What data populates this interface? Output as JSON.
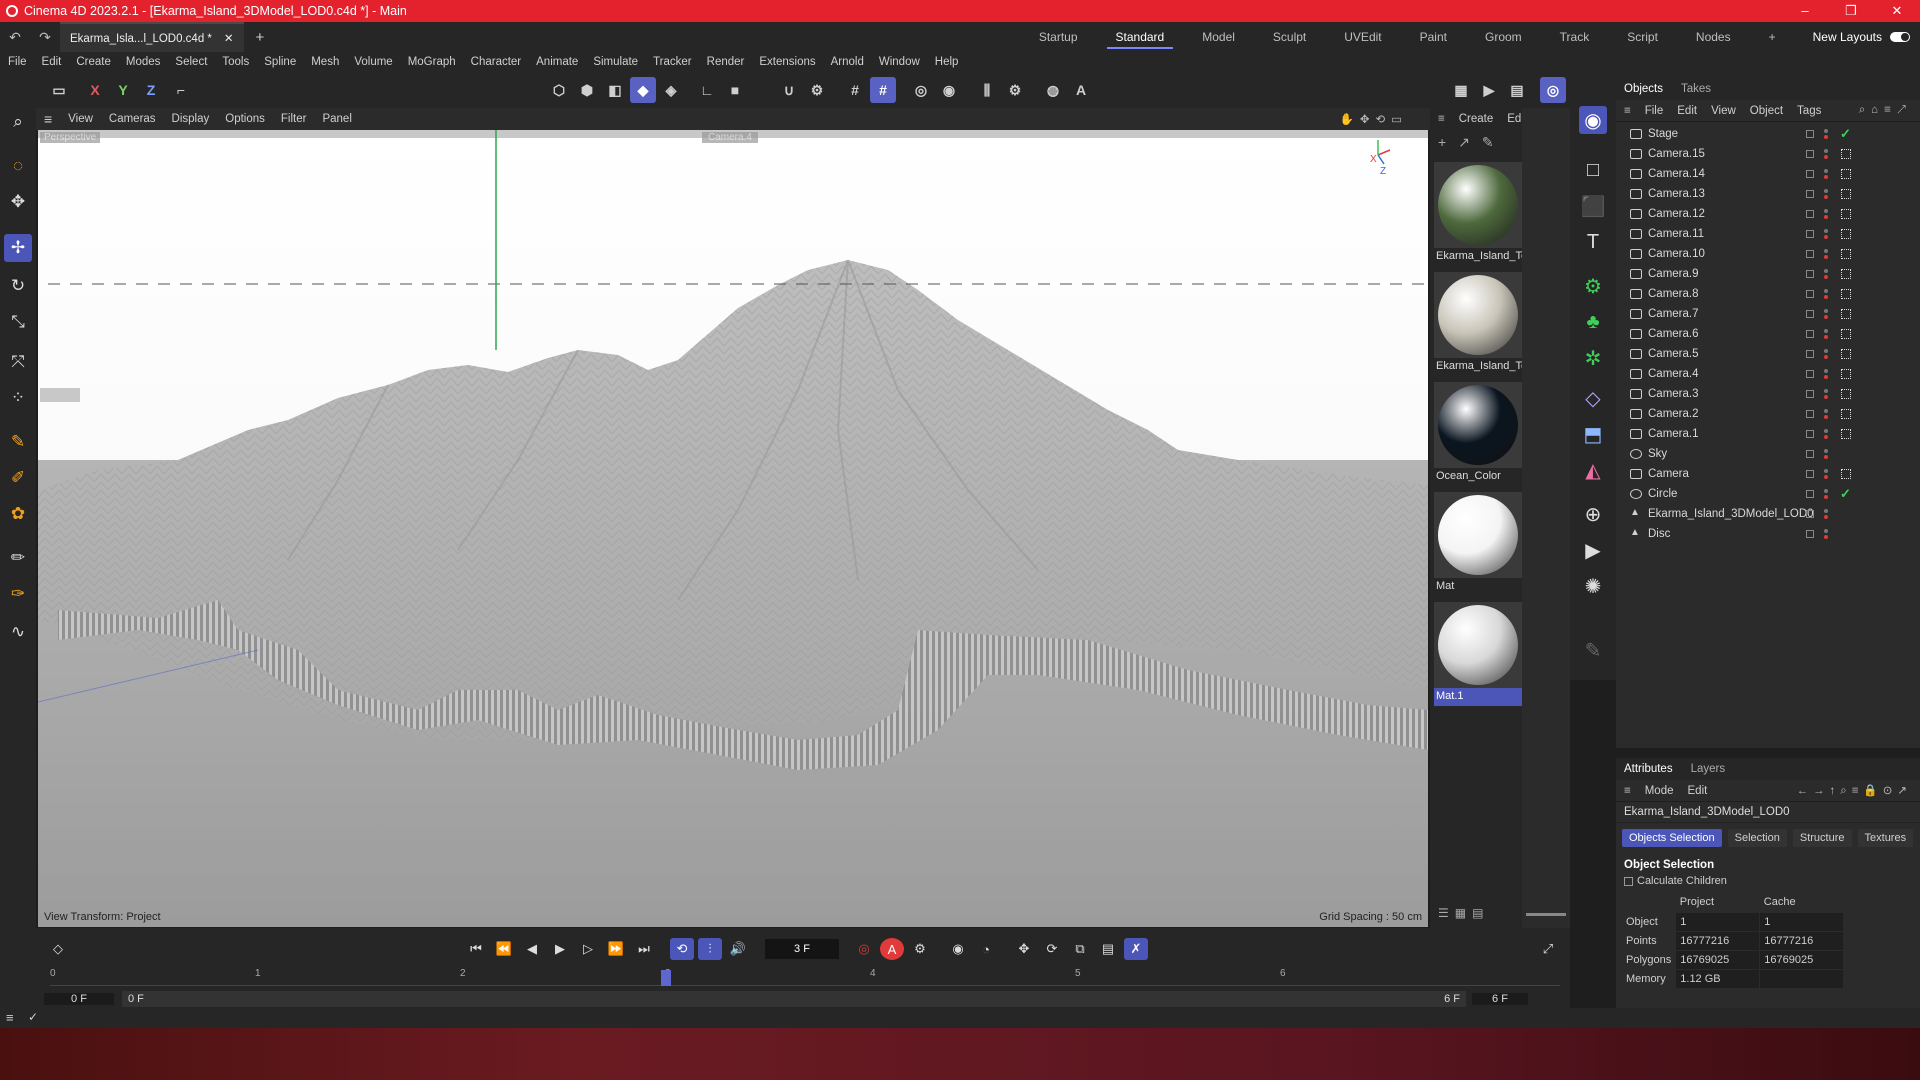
{
  "window": {
    "title": "Cinema 4D 2023.2.1 - [Ekarma_Island_3DModel_LOD0.c4d *] - Main",
    "controls": [
      "–",
      "❐",
      "✕"
    ]
  },
  "doc_tab": {
    "label": "Ekarma_Isla...l_LOD0.c4d *",
    "close": "✕",
    "new": "+"
  },
  "layouts": {
    "tabs": [
      "Startup",
      "Standard",
      "Model",
      "Sculpt",
      "UVEdit",
      "Paint",
      "Groom",
      "Track",
      "Script",
      "Nodes"
    ],
    "active": "Standard",
    "add": "+",
    "new_layouts": "New Layouts"
  },
  "menu": [
    "File",
    "Edit",
    "Create",
    "Modes",
    "Select",
    "Tools",
    "Spline",
    "Mesh",
    "Volume",
    "MoGraph",
    "Character",
    "Animate",
    "Simulate",
    "Tracker",
    "Render",
    "Extensions",
    "Arnold",
    "Window",
    "Help"
  ],
  "axis_buttons": [
    "X",
    "Y",
    "Z"
  ],
  "viewport": {
    "menu": [
      "View",
      "Cameras",
      "Display",
      "Options",
      "Filter",
      "Panel"
    ],
    "label_left": "Perspective",
    "label_center": "Camera.4",
    "view_transform": "View Transform: Project",
    "grid_spacing": "Grid Spacing : 50 cm",
    "axis_x": "X",
    "axis_z": "Z"
  },
  "materials": {
    "menu": [
      "Create",
      "Edit"
    ],
    "items": [
      {
        "name": "Ekarma_Island_Te",
        "color": "#4f6a3e"
      },
      {
        "name": "Ekarma_Island_Te",
        "color": "#c8c4b8"
      },
      {
        "name": "Ocean_Color",
        "color": "#0b1520"
      },
      {
        "name": "Mat",
        "color": "#f4f4f4"
      },
      {
        "name": "Mat.1",
        "color": "#d8d8d8"
      }
    ],
    "selected": "Mat.1"
  },
  "objects": {
    "tabs": [
      "Objects",
      "Takes"
    ],
    "menu": [
      "File",
      "Edit",
      "View",
      "Object",
      "Tags"
    ],
    "items": [
      {
        "name": "Stage",
        "icon": "stage-icon"
      },
      {
        "name": "Camera.15",
        "icon": "camera-icon"
      },
      {
        "name": "Camera.14",
        "icon": "camera-icon"
      },
      {
        "name": "Camera.13",
        "icon": "camera-icon"
      },
      {
        "name": "Camera.12",
        "icon": "camera-icon"
      },
      {
        "name": "Camera.11",
        "icon": "camera-icon"
      },
      {
        "name": "Camera.10",
        "icon": "camera-icon"
      },
      {
        "name": "Camera.9",
        "icon": "camera-icon"
      },
      {
        "name": "Camera.8",
        "icon": "camera-icon"
      },
      {
        "name": "Camera.7",
        "icon": "camera-icon"
      },
      {
        "name": "Camera.6",
        "icon": "camera-icon"
      },
      {
        "name": "Camera.5",
        "icon": "camera-icon"
      },
      {
        "name": "Camera.4",
        "icon": "camera-icon"
      },
      {
        "name": "Camera.3",
        "icon": "camera-icon"
      },
      {
        "name": "Camera.2",
        "icon": "camera-icon"
      },
      {
        "name": "Camera.1",
        "icon": "camera-icon"
      },
      {
        "name": "Sky",
        "icon": "sky-icon"
      },
      {
        "name": "Camera",
        "icon": "camera-icon"
      },
      {
        "name": "Circle",
        "icon": "circle-icon"
      },
      {
        "name": "Ekarma_Island_3DModel_LOD0",
        "icon": "polygon-icon"
      },
      {
        "name": "Disc",
        "icon": "polygon-icon"
      }
    ]
  },
  "attributes": {
    "tabs": [
      "Attributes",
      "Layers"
    ],
    "menu": [
      "Mode",
      "Edit"
    ],
    "object_name": "Ekarma_Island_3DModel_LOD0",
    "subtabs": [
      "Objects Selection",
      "Selection",
      "Structure",
      "Textures"
    ],
    "section": "Object Selection",
    "calculate_children": "Calculate Children",
    "columns": [
      "Project",
      "Cache"
    ],
    "rows": [
      {
        "label": "Object",
        "project": "1",
        "cache": "1"
      },
      {
        "label": "Points",
        "project": "16777216",
        "cache": "16777216"
      },
      {
        "label": "Polygons",
        "project": "16769025",
        "cache": "16769025"
      },
      {
        "label": "Memory",
        "project": "1.12 GB",
        "cache": ""
      }
    ]
  },
  "timeline": {
    "current_frame": "3 F",
    "ticks": [
      "0",
      "1",
      "2",
      "3",
      "4",
      "5",
      "6"
    ],
    "playhead_frame": 3,
    "range_start": "0 F",
    "range_min": "0 F",
    "range_max": "6 F",
    "range_end": "6 F"
  }
}
